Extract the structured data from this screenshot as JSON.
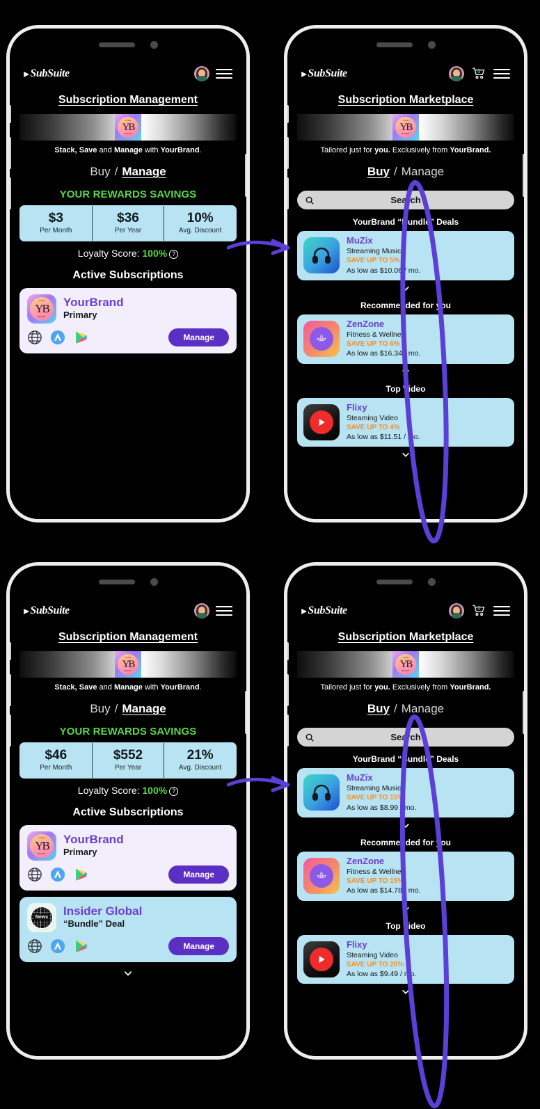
{
  "brand": {
    "mark": "⫸",
    "name": "SubSuite"
  },
  "icons": {
    "avatar": "avatar-icon",
    "cart": "shopping-cart-icon",
    "menu": "hamburger-menu-icon",
    "search": "search-icon",
    "chevron": "chevron-down-icon",
    "help": "?",
    "globe": "globe-icon",
    "appstore": "app-store-icon",
    "playstore": "google-play-icon"
  },
  "colors": {
    "accent_purple": "#5b2fc4",
    "link_purple": "#6b3fd4",
    "savings_green": "#58d948",
    "card_blue": "#b7e3f2",
    "card_lavender": "#f2eefc",
    "save_orange": "#f4902b",
    "annotation_purple": "#5b3fd6"
  },
  "cart_badge": "0",
  "manage_screen": {
    "title": "Subscription Management",
    "tagline": {
      "a": "Stack, Save",
      "b": " and ",
      "c": "Manage",
      "d": " with ",
      "e": "YourBrand",
      "f": "."
    },
    "toggle": {
      "buy": "Buy",
      "sep": "/",
      "manage": "Manage",
      "active": "Manage"
    },
    "rewards_title": "YOUR REWARDS SAVINGS",
    "loyalty_label": "Loyalty Score:",
    "loyalty_value": "100%",
    "active_title": "Active Subscriptions",
    "variant_a": {
      "stats": [
        {
          "value": "$3",
          "label": "Per Month"
        },
        {
          "value": "$36",
          "label": "Per Year"
        },
        {
          "value": "10%",
          "label": "Avg. Discount"
        }
      ],
      "subs": [
        {
          "name": "YourBrand",
          "sub": "Primary",
          "action": "Manage",
          "icon": "yourbrand-tile"
        }
      ]
    },
    "variant_b": {
      "stats": [
        {
          "value": "$46",
          "label": "Per Month"
        },
        {
          "value": "$552",
          "label": "Per Year"
        },
        {
          "value": "21%",
          "label": "Avg. Discount"
        }
      ],
      "subs": [
        {
          "name": "YourBrand",
          "sub": "Primary",
          "action": "Manage",
          "icon": "yourbrand-tile"
        },
        {
          "name": "Insider Global",
          "sub": "“Bundle” Deal",
          "action": "Manage",
          "icon": "news-globe-tile"
        }
      ]
    }
  },
  "marketplace_screen": {
    "title": "Subscription Marketplace",
    "tagline": {
      "a": "Tailored just for ",
      "b": "you.",
      "c": " Exclusively from ",
      "d": "YourBrand.",
      "e": ""
    },
    "toggle": {
      "buy": "Buy",
      "sep": "/",
      "manage": "Manage",
      "active": "Buy"
    },
    "search_placeholder": "Search",
    "sections": [
      {
        "heading": "YourBrand “Bundle” Deals"
      },
      {
        "heading": "Recommended for you"
      },
      {
        "heading": "Top Video"
      }
    ],
    "variant_a": {
      "deals": [
        {
          "name": "MuZix",
          "category": "Streaming Music",
          "save": "SAVE UP TO 5%",
          "price": "As low as $10.06 / mo.",
          "icon": "headphones-icon"
        },
        {
          "name": "ZenZone",
          "category": "Fitness & Wellnes",
          "save": "SAVE UP TO 6%",
          "price": "As low as $16.34 / mo.",
          "icon": "lotus-icon"
        },
        {
          "name": "Flixy",
          "category": "Steaming Video",
          "save": "SAVE UP TO 4%",
          "price": "As low as $11.51 / mo.",
          "icon": "play-button-icon"
        }
      ]
    },
    "variant_b": {
      "deals": [
        {
          "name": "MuZix",
          "category": "Streaming Music",
          "save": "SAVE UP TO 15%",
          "price": "As low as $8.99 / mo.",
          "icon": "headphones-icon"
        },
        {
          "name": "ZenZone",
          "category": "Fitness & Wellnes",
          "save": "SAVE UP TO 15%",
          "price": "As low as $14.78 / mo.",
          "icon": "lotus-icon"
        },
        {
          "name": "Flixy",
          "category": "Steaming Video",
          "save": "SAVE UP TO 20%",
          "price": "As low as $9.49 / mo.",
          "icon": "play-button-icon"
        }
      ]
    }
  }
}
